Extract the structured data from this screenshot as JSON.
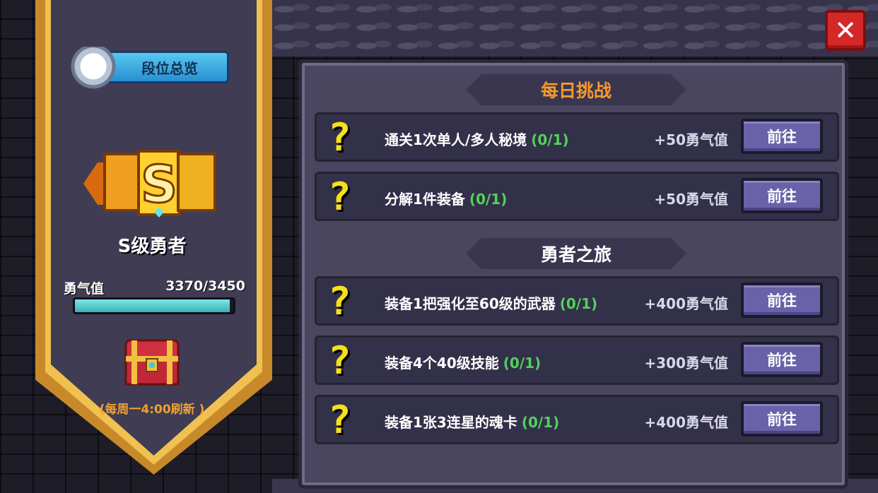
{
  "left_panel": {
    "rank_overview_label": "段位总览",
    "rank_name": "S级勇者",
    "courage_label": "勇气值",
    "courage_value": "3370/3450",
    "courage_progress": 0.977,
    "refresh_note": "(每周一4:00刷新 )"
  },
  "panel": {
    "daily_header": "每日挑战",
    "journey_header": "勇者之旅"
  },
  "daily_tasks": [
    {
      "desc": "通关1次单人/多人秘境",
      "progress": "(0/1)",
      "reward": "+50勇气值",
      "button": "前往"
    },
    {
      "desc": "分解1件装备",
      "progress": "(0/1)",
      "reward": "+50勇气值",
      "button": "前往"
    }
  ],
  "journey_tasks": [
    {
      "desc": "装备1把强化至60级的武器",
      "progress": "(0/1)",
      "reward": "+400勇气值",
      "button": "前往"
    },
    {
      "desc": "装备4个40级技能",
      "progress": "(0/1)",
      "reward": "+300勇气值",
      "button": "前往"
    },
    {
      "desc": "装备1张3连星的魂卡",
      "progress": "(0/1)",
      "reward": "+400勇气值",
      "button": "前往"
    }
  ],
  "icons": {
    "task_icon": "question-mark-icon",
    "close": "close-icon",
    "crest": "rank-crest-icon",
    "chest": "treasure-chest-icon",
    "logo": "rank-s-logo-icon"
  },
  "colors": {
    "accent_orange": "#f59a2c",
    "progress_green": "#52d25a",
    "close_red": "#d42828",
    "button_purple": "#6a62a8"
  }
}
